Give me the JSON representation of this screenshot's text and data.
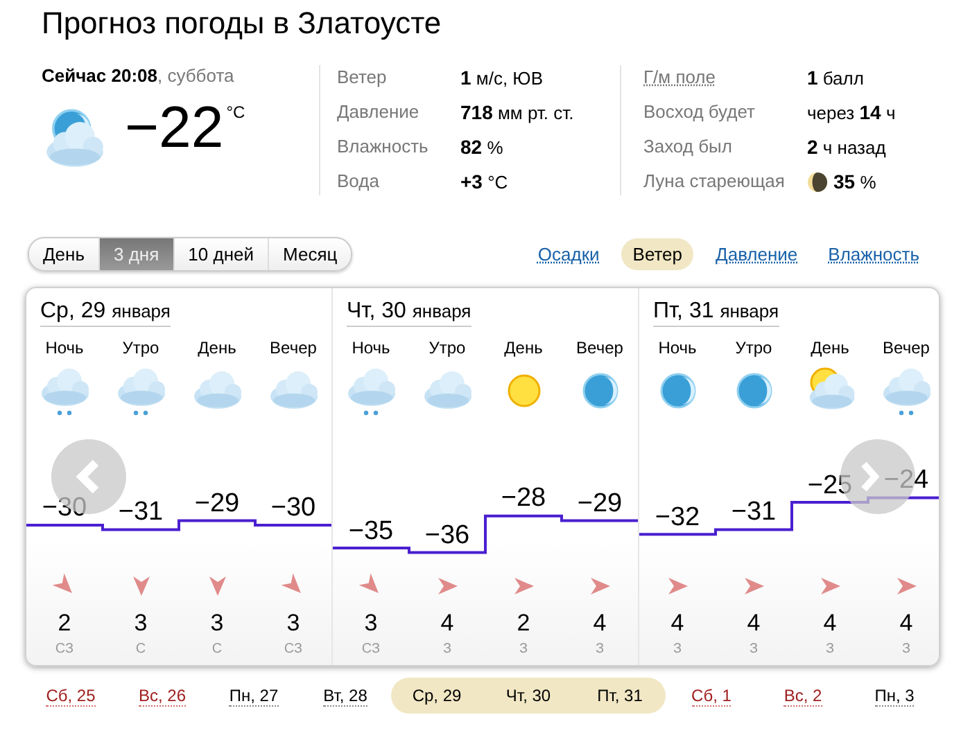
{
  "title": "Прогноз погоды в Златоусте",
  "now": {
    "label": "Сейчас 20:08",
    "weekday": ", суббота",
    "icon": {
      "kind": "moon-cloud"
    },
    "temperature": "−22",
    "unit": "°C"
  },
  "details": [
    [
      {
        "label": "Ветер",
        "value": "**1** м/с, ЮВ",
        "kind": "plain"
      },
      {
        "label": "Давление",
        "value": "**718** мм рт. ст.",
        "kind": "plain"
      },
      {
        "label": "Влажность",
        "value": "**82** %",
        "kind": "plain"
      },
      {
        "label": "Вода",
        "value": "**+3** °C",
        "kind": "plain"
      }
    ],
    [
      {
        "label": "Г/м поле",
        "value": "**1** балл",
        "kind": "link"
      },
      {
        "label": "Восход будет",
        "value": "через **14** ч",
        "kind": "plain"
      },
      {
        "label": "Заход был",
        "value": "**2** ч назад",
        "kind": "plain"
      },
      {
        "label": "Луна стареющая",
        "value": "**35** %",
        "kind": "moon"
      }
    ]
  ],
  "ranges": [
    {
      "label": "День",
      "selected": false
    },
    {
      "label": "3 дня",
      "selected": true
    },
    {
      "label": "10 дней",
      "selected": false
    },
    {
      "label": "Месяц",
      "selected": false
    }
  ],
  "layers": [
    {
      "label": "Осадки",
      "selected": false
    },
    {
      "label": "Ветер",
      "selected": true
    },
    {
      "label": "Давление",
      "selected": false
    },
    {
      "label": "Влажность",
      "selected": false
    }
  ],
  "days": [
    {
      "day": "Ср, 29",
      "month": "января",
      "periods": [
        {
          "name": "Ночь",
          "weather": {
            "kind": "cloud-snow"
          },
          "temperature": "−30",
          "wind": {
            "kind": "down-right",
            "speed": "2",
            "direction": "СЗ"
          }
        },
        {
          "name": "Утро",
          "weather": {
            "kind": "cloud-snow"
          },
          "temperature": "−31",
          "wind": {
            "kind": "down",
            "speed": "3",
            "direction": "С"
          }
        },
        {
          "name": "День",
          "weather": {
            "kind": "cloud"
          },
          "temperature": "−29",
          "wind": {
            "kind": "down",
            "speed": "3",
            "direction": "С"
          }
        },
        {
          "name": "Вечер",
          "weather": {
            "kind": "cloud"
          },
          "temperature": "−30",
          "wind": {
            "kind": "down-right",
            "speed": "3",
            "direction": "СЗ"
          }
        }
      ]
    },
    {
      "day": "Чт, 30",
      "month": "января",
      "periods": [
        {
          "name": "Ночь",
          "weather": {
            "kind": "cloud-snow"
          },
          "temperature": "−35",
          "wind": {
            "kind": "down-right",
            "speed": "3",
            "direction": "СЗ"
          }
        },
        {
          "name": "Утро",
          "weather": {
            "kind": "cloud"
          },
          "temperature": "−36",
          "wind": {
            "kind": "right",
            "speed": "4",
            "direction": "З"
          }
        },
        {
          "name": "День",
          "weather": {
            "kind": "sun"
          },
          "temperature": "−28",
          "wind": {
            "kind": "right",
            "speed": "2",
            "direction": "З"
          }
        },
        {
          "name": "Вечер",
          "weather": {
            "kind": "moon"
          },
          "temperature": "−29",
          "wind": {
            "kind": "right",
            "speed": "4",
            "direction": "З"
          }
        }
      ]
    },
    {
      "day": "Пт, 31",
      "month": "января",
      "periods": [
        {
          "name": "Ночь",
          "weather": {
            "kind": "moon"
          },
          "temperature": "−32",
          "wind": {
            "kind": "right",
            "speed": "4",
            "direction": "З"
          }
        },
        {
          "name": "Утро",
          "weather": {
            "kind": "moon"
          },
          "temperature": "−31",
          "wind": {
            "kind": "right",
            "speed": "4",
            "direction": "З"
          }
        },
        {
          "name": "День",
          "weather": {
            "kind": "sun-cloud"
          },
          "temperature": "−25",
          "wind": {
            "kind": "right",
            "speed": "4",
            "direction": "З"
          }
        },
        {
          "name": "Вечер",
          "weather": {
            "kind": "cloud-snow"
          },
          "temperature": "−24",
          "wind": {
            "kind": "right",
            "speed": "4",
            "direction": "З"
          }
        }
      ]
    }
  ],
  "dates": [
    {
      "label": "Сб, 25",
      "weekend": true,
      "selected": false
    },
    {
      "label": "Вс, 26",
      "weekend": true,
      "selected": false
    },
    {
      "label": "Пн, 27",
      "weekend": false,
      "selected": false
    },
    {
      "label": "Вт, 28",
      "weekend": false,
      "selected": false
    },
    {
      "label": "Ср, 29",
      "weekend": false,
      "selected": true
    },
    {
      "label": "Чт, 30",
      "weekend": false,
      "selected": true
    },
    {
      "label": "Пт, 31",
      "weekend": false,
      "selected": true
    },
    {
      "label": "Сб, 1",
      "weekend": true,
      "selected": false
    },
    {
      "label": "Вс, 2",
      "weekend": true,
      "selected": false
    },
    {
      "label": "Пн, 3",
      "weekend": false,
      "selected": false
    }
  ]
}
